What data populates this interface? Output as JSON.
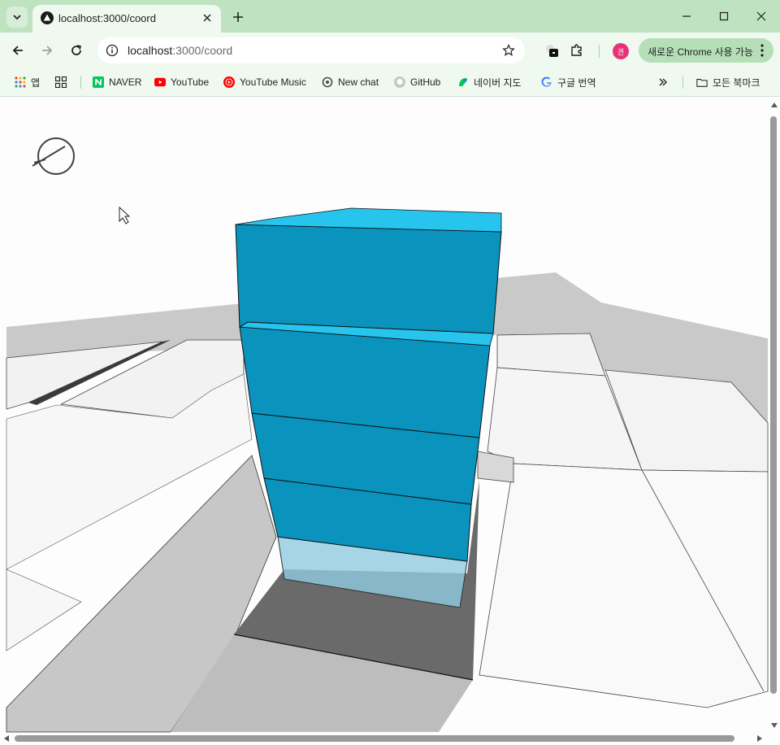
{
  "tab": {
    "title": "localhost:3000/coord",
    "favicon": "app-triangle-icon"
  },
  "toolbar": {
    "url_host": "localhost",
    "url_rest": ":3000/coord",
    "promo_label": "새로운 Chrome 사용 가능",
    "avatar_initial": "권"
  },
  "bookmarks": [
    {
      "label": "앱",
      "icon": "apps-grid-icon"
    },
    {
      "label": "",
      "icon": "tab-groups-icon"
    },
    {
      "label": "NAVER",
      "icon": "naver-icon"
    },
    {
      "label": "YouTube",
      "icon": "youtube-icon"
    },
    {
      "label": "YouTube Music",
      "icon": "youtube-music-icon"
    },
    {
      "label": "New chat",
      "icon": "openai-icon"
    },
    {
      "label": "GitHub",
      "icon": "github-icon"
    },
    {
      "label": "네이버 지도",
      "icon": "naver-map-icon"
    },
    {
      "label": "구글 번역",
      "icon": "google-icon"
    }
  ],
  "all_bookmarks_label": "모든 북마크",
  "colors": {
    "chrome_tabstrip": "#bfe3c0",
    "chrome_toolbar": "#f0f9f0",
    "building_front": "#0a93bd",
    "building_top": "#27c4ee",
    "ground": "#f4f4f4",
    "shadow": "#6a6a6a"
  }
}
